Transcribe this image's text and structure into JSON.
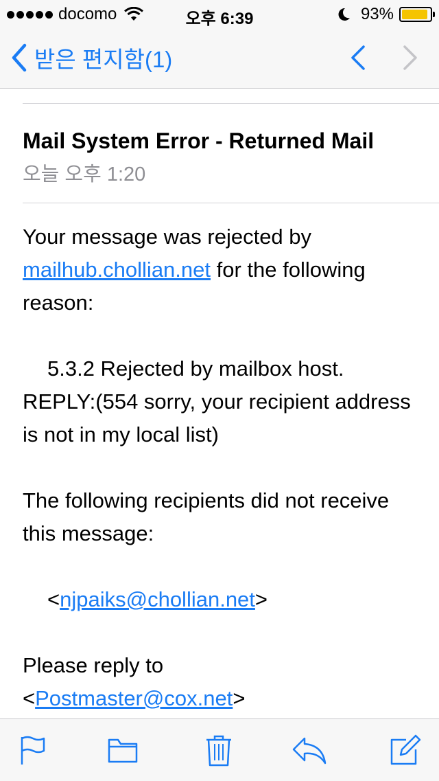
{
  "status_bar": {
    "carrier": "docomo",
    "time": "오후 6:39",
    "battery_percent": "93%",
    "battery_level": 0.93,
    "icons": [
      "signal-dots",
      "wifi-icon",
      "moon-icon",
      "battery-icon"
    ]
  },
  "nav": {
    "back_label": "받은 편지함(1)",
    "prev_icon": "chevron-up-icon",
    "next_icon": "chevron-down-icon",
    "accent_color": "#1a7cf4"
  },
  "email": {
    "subject": "Mail System Error - Returned Mail",
    "date": "오늘 오후 1:20",
    "body": {
      "p1_before": "Your message was rejected by ",
      "p1_link": "mailhub.chollian.net",
      "p1_after": " for the following reason:",
      "p2": "5.3.2 Rejected by mailbox host.",
      "p2_cont": "REPLY:(554 sorry, your recipient address is not in my local list)",
      "p3": "The following recipients did not receive this message:",
      "p4_before": "<",
      "p4_link": "njpaiks@chollian.net",
      "p4_after": ">",
      "p5": "Please reply to",
      "p5_before": "<",
      "p5_link": "Postmaster@cox.net",
      "p5_after": ">"
    }
  },
  "toolbar": {
    "icons": [
      "flag-icon",
      "folder-icon",
      "trash-icon",
      "reply-icon",
      "compose-icon"
    ]
  }
}
